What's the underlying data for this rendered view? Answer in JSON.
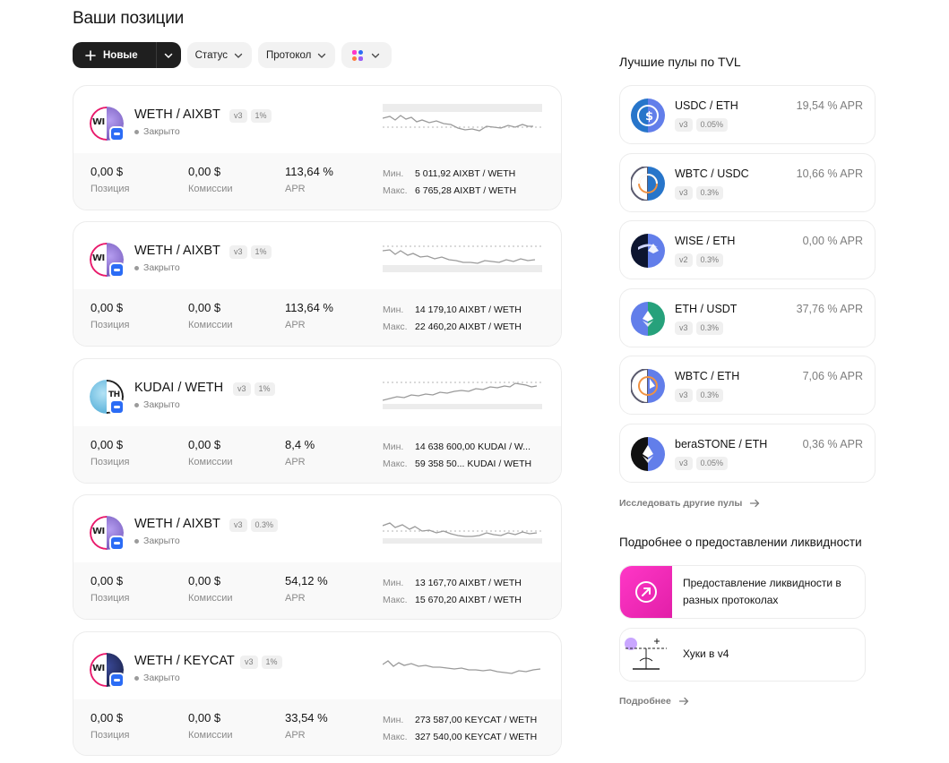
{
  "page": {
    "title": "Ваши позиции"
  },
  "filters": {
    "new_label": "Новые",
    "status_label": "Статус",
    "protocol_label": "Протокол"
  },
  "colors": {
    "accent": "#131313",
    "muted": "#7d7d7d",
    "chain": "#2b6cf5",
    "pink": "#ff37c7"
  },
  "labels": {
    "position": "Позиция",
    "fees": "Комиссии",
    "apr": "APR",
    "min": "Мин.",
    "max": "Макс."
  },
  "positions": [
    {
      "pair": "WETH / AIXBT",
      "version": "v3",
      "fee": "1%",
      "status": "Закрыто",
      "position": "0,00 $",
      "fees": "0,00 $",
      "apr": "113,64 %",
      "min": "5 011,92 AIXBT / WETH",
      "max": "6 765,28 AIXBT / WETH"
    },
    {
      "pair": "WETH / AIXBT",
      "version": "v3",
      "fee": "1%",
      "status": "Закрыто",
      "position": "0,00 $",
      "fees": "0,00 $",
      "apr": "113,64 %",
      "min": "14 179,10 AIXBT / WETH",
      "max": "22 460,20 AIXBT / WETH"
    },
    {
      "pair": "KUDAI / WETH",
      "version": "v3",
      "fee": "1%",
      "status": "Закрыто",
      "position": "0,00 $",
      "fees": "0,00 $",
      "apr": "8,4 %",
      "min": "14 638 600,00 KUDAI / W...",
      "max": "59 358 50...   KUDAI / WETH"
    },
    {
      "pair": "WETH / AIXBT",
      "version": "v3",
      "fee": "0.3%",
      "status": "Закрыто",
      "position": "0,00 $",
      "fees": "0,00 $",
      "apr": "54,12 %",
      "min": "13 167,70 AIXBT / WETH",
      "max": "15 670,20 AIXBT / WETH"
    },
    {
      "pair": "WETH / KEYCAT",
      "version": "v3",
      "fee": "1%",
      "status": "Закрыто",
      "position": "0,00 $",
      "fees": "0,00 $",
      "apr": "33,54 %",
      "min": "273 587,00 KEYCAT / WETH",
      "max": "327 540,00 KEYCAT / WETH"
    }
  ],
  "side": {
    "title": "Лучшие пулы по TVL",
    "pools": [
      {
        "name": "USDC / ETH",
        "apr": "19,54 % APR",
        "version": "v3",
        "fee": "0.05%"
      },
      {
        "name": "WBTC / USDC",
        "apr": "10,66 % APR",
        "version": "v3",
        "fee": "0.3%"
      },
      {
        "name": "WISE / ETH",
        "apr": "0,00 % APR",
        "version": "v2",
        "fee": "0.3%"
      },
      {
        "name": "ETH / USDT",
        "apr": "37,76 % APR",
        "version": "v3",
        "fee": "0.3%"
      },
      {
        "name": "WBTC / ETH",
        "apr": "7,06 % APR",
        "version": "v3",
        "fee": "0.3%"
      },
      {
        "name": "beraSTONE / ETH",
        "apr": "0,36 % APR",
        "version": "v3",
        "fee": "0.05%"
      }
    ],
    "explore_label": "Исследовать другие пулы",
    "learn_title": "Подробнее о предоставлении ликвидности",
    "learn_items": [
      {
        "text": "Предоставление ликвидности в разных протоколах"
      },
      {
        "text": "Хуки в v4"
      }
    ],
    "more_label": "Подробнее"
  }
}
